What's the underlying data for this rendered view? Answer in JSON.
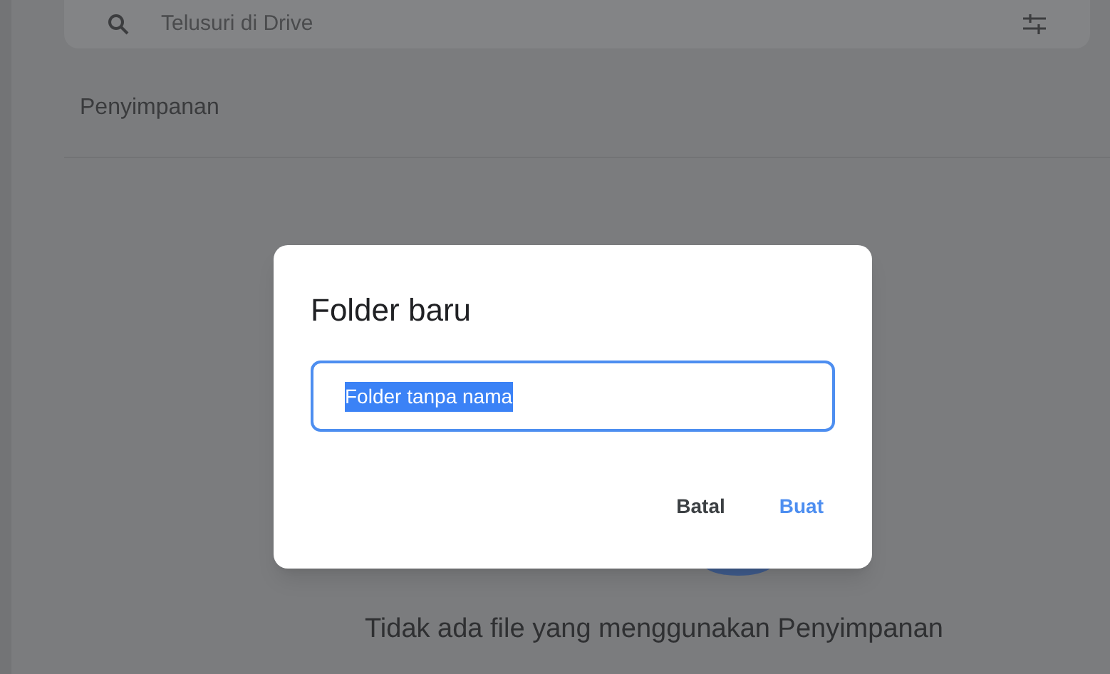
{
  "search": {
    "placeholder": "Telusuri di Drive"
  },
  "section_title": "Penyimpanan",
  "empty_message": "Tidak ada file yang menggunakan Penyimpanan",
  "dialog": {
    "title": "Folder baru",
    "field": {
      "value": "Folder tanpa nama",
      "selected": true
    },
    "buttons": [
      {
        "label": "Batal",
        "kind": "secondary"
      },
      {
        "label": "Buat",
        "kind": "primary"
      }
    ]
  }
}
